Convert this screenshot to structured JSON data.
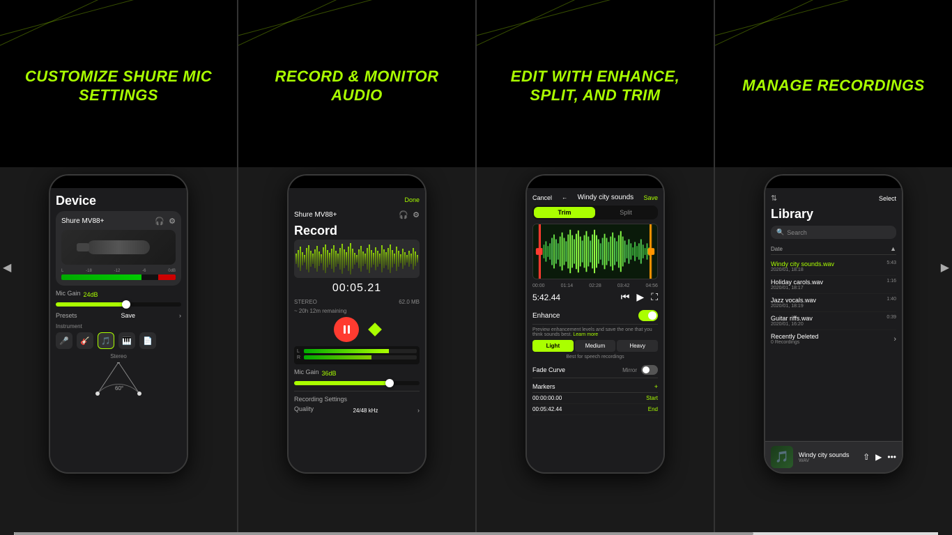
{
  "cards": [
    {
      "id": "card-customize",
      "title": "CUSTOMIZE SHURE MiC SETTINGS",
      "screen": {
        "main_title": "Device",
        "device_name": "Shure MV88+",
        "mic_gain_label": "Mic Gain",
        "mic_gain_value": "24dB",
        "presets_label": "Presets",
        "presets_save": "Save",
        "instrument_label": "Instrument",
        "stereo_label": "Stereo",
        "stereo_angle": "60°"
      }
    },
    {
      "id": "card-record",
      "title": "RECORD & MONITOR AUDIO",
      "screen": {
        "done_label": "Done",
        "main_title": "Record",
        "device_name": "Shure MV88+",
        "timer": "00:05.21",
        "channel": "STEREO",
        "file_size": "62.0 MB",
        "time_remaining": "~ 20h 12m remaining",
        "mic_gain_label": "Mic Gain",
        "mic_gain_value": "36dB",
        "recording_settings": "Recording Settings",
        "quality_label": "Quality",
        "quality_value": "24/48 kHz"
      }
    },
    {
      "id": "card-edit",
      "title": "EDIT WITH ENHANCE, SPLIT, AND TRIM",
      "screen": {
        "cancel_label": "Cancel",
        "file_name": "Windy city sounds",
        "save_label": "Save",
        "trim_tab": "Trim",
        "split_tab": "Split",
        "time_display": "5:42.44",
        "time_labels": [
          "00:00",
          "01:14",
          "02:28",
          "03:42",
          "04:56"
        ],
        "enhance_label": "Enhance",
        "enhance_desc": "Preview enhancement levels and save the one that you think sounds best.",
        "learn_more": "Learn more",
        "enhance_light": "Light",
        "enhance_medium": "Medium",
        "enhance_heavy": "Heavy",
        "enhance_best_text": "Best for speech recordings",
        "fade_curve_label": "Fade Curve",
        "mirror_label": "Mirror",
        "markers_label": "Markers",
        "marker1_time": "00:00:00.00",
        "marker1_type": "Start",
        "marker2_time": "00:05:42.44",
        "marker2_type": "End"
      }
    },
    {
      "id": "card-library",
      "title": "MANAGE RECORDINGS",
      "screen": {
        "select_label": "Select",
        "main_title": "Library",
        "search_placeholder": "Search",
        "date_filter": "Date",
        "recordings": [
          {
            "name": "Windy city sounds.wav",
            "date": "2020/01, 18:18",
            "duration": "5:43",
            "highlighted": true
          },
          {
            "name": "Holiday carols.wav",
            "date": "2020/01, 18:17",
            "duration": "1:16"
          },
          {
            "name": "Jazz vocals.wav",
            "date": "2020/01, 18:19",
            "duration": "1:40"
          },
          {
            "name": "Guitar riffs.wav",
            "date": "2020/01, 16:20",
            "duration": "0:39"
          }
        ],
        "recently_deleted": "Recently Deleted",
        "recently_deleted_count": "0 Recordings",
        "now_playing_title": "Windy city sounds",
        "now_playing_format": "WAV"
      }
    }
  ],
  "scroll": {
    "left_arrow": "◀",
    "right_arrow": "▶"
  }
}
